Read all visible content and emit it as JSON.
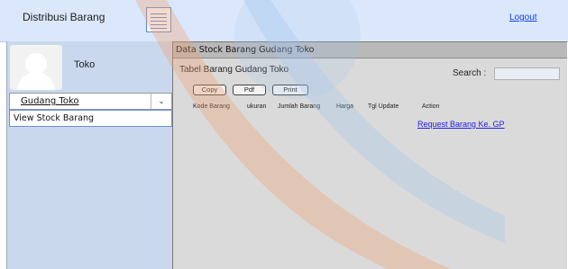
{
  "header": {
    "app_title": "Distribusi Barang",
    "logout_label": "Logout"
  },
  "sidebar": {
    "user_role": "Toko",
    "dropdown": {
      "selected": "Gudang Toko"
    },
    "menu_items": [
      {
        "label": "View Stock Barang"
      }
    ]
  },
  "main": {
    "panel_title": "Data Stock Barang Gudang Toko",
    "table_title": "Tabel Barang Gudang Toko",
    "search": {
      "label": "Search :",
      "value": ""
    },
    "buttons": {
      "copy": "Copy",
      "pdf": "Pdf",
      "print": "Print"
    },
    "columns": [
      "Kode Barang",
      "ukuran",
      "Jumlah Barang",
      "Harga",
      "Tgl Update",
      "Action"
    ],
    "request_link": "Request Barang Ke. GP"
  },
  "colors": {
    "header_bg": "#dbe8fb",
    "sidebar_bg": "#c9d8ec",
    "main_bg": "#dadada",
    "link": "#1040ff",
    "watermark_orange": "#f0a070",
    "watermark_blue": "#9fc4ef"
  },
  "icons": {
    "menu": "menu-list-icon",
    "dropdown": "chevron-down-icon",
    "avatar": "user-avatar-icon"
  }
}
